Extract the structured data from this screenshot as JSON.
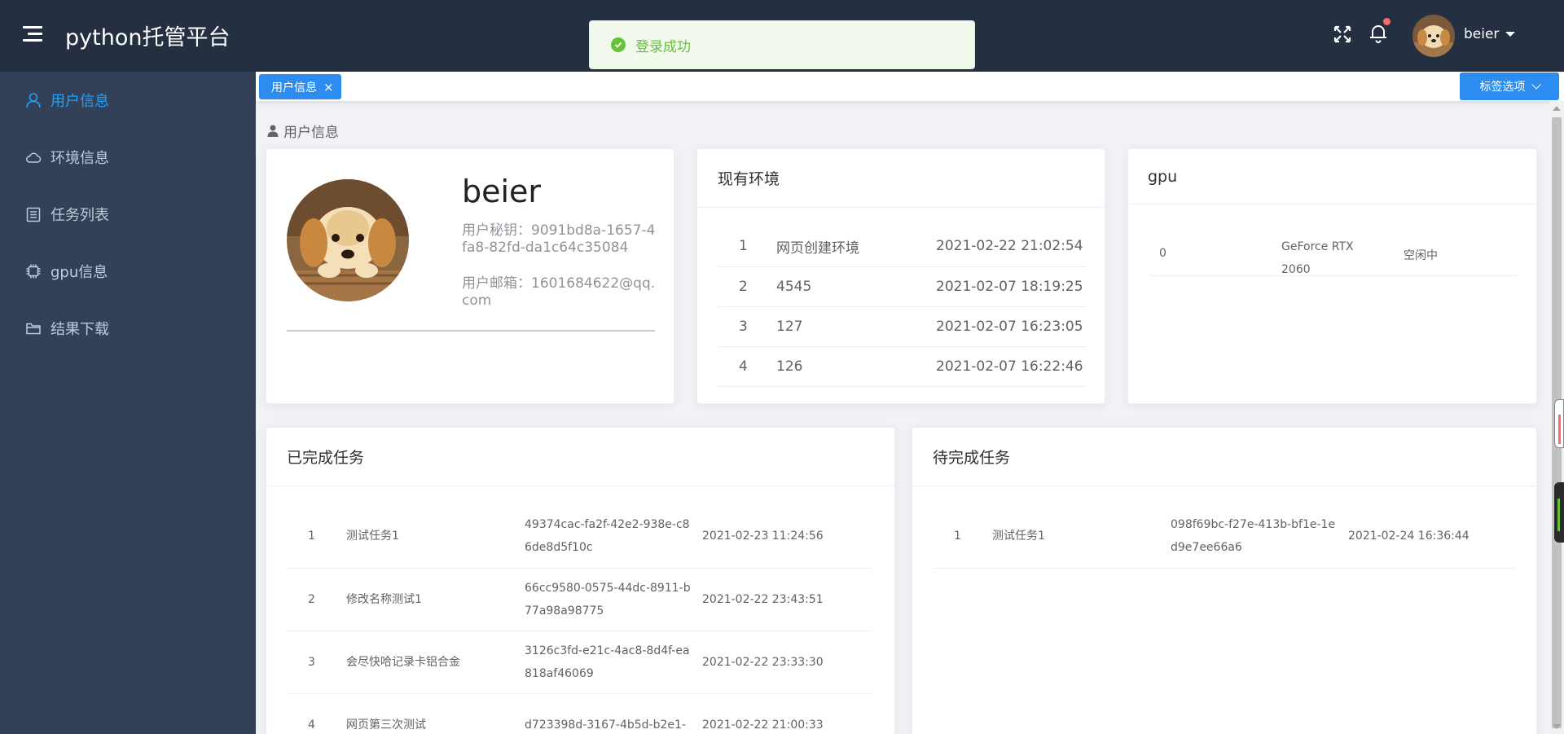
{
  "header": {
    "brand": "python托管平台",
    "username": "beier"
  },
  "toast": {
    "message": "登录成功",
    "color": "#67c23a"
  },
  "sidebar": {
    "items": [
      {
        "label": "用户信息",
        "icon": "user-icon",
        "active": true
      },
      {
        "label": "环境信息",
        "icon": "cloud-icon",
        "active": false
      },
      {
        "label": "任务列表",
        "icon": "list-icon",
        "active": false
      },
      {
        "label": "gpu信息",
        "icon": "chip-icon",
        "active": false
      },
      {
        "label": "结果下载",
        "icon": "folder-icon",
        "active": false
      }
    ]
  },
  "tags": {
    "active_tag": "用户信息",
    "options_label": "标签选项"
  },
  "breadcrumb": {
    "label": "用户信息"
  },
  "user_card": {
    "name": "beier",
    "secret": "用户秘钥：9091bd8a-1657-4fa8-82fd-da1c64c35084",
    "email": "用户邮箱：1601684622@qq.com"
  },
  "env_card": {
    "title": "现有环境",
    "rows": [
      {
        "index": "1",
        "name": "网页创建环境",
        "time": "2021-02-22 21:02:54"
      },
      {
        "index": "2",
        "name": "4545",
        "time": "2021-02-07 18:19:25"
      },
      {
        "index": "3",
        "name": "127",
        "time": "2021-02-07 16:23:05"
      },
      {
        "index": "4",
        "name": "126",
        "time": "2021-02-07 16:22:46"
      }
    ]
  },
  "gpu_card": {
    "title": "gpu",
    "rows": [
      {
        "index": "0",
        "model": "GeForce RTX 2060",
        "status": "空闲中"
      }
    ]
  },
  "done_card": {
    "title": "已完成任务",
    "rows": [
      {
        "index": "1",
        "name": "测试任务1",
        "id": "49374cac-fa2f-42e2-938e-c86de8d5f10c",
        "time": "2021-02-23 11:24:56"
      },
      {
        "index": "2",
        "name": "修改名称测试1",
        "id": "66cc9580-0575-44dc-8911-b77a98a98775",
        "time": "2021-02-22 23:43:51"
      },
      {
        "index": "3",
        "name": "会尽快哈记录卡铝合金",
        "id": "3126c3fd-e21c-4ac8-8d4f-ea818af46069",
        "time": "2021-02-22 23:33:30"
      },
      {
        "index": "4",
        "name": "网页第三次测试",
        "id": "d723398d-3167-4b5d-b2e1-",
        "time": "2021-02-22 21:00:33"
      }
    ]
  },
  "todo_card": {
    "title": "待完成任务",
    "rows": [
      {
        "index": "1",
        "name": "测试任务1",
        "id": "098f69bc-f27e-413b-bf1e-1ed9e7ee66a6",
        "time": "2021-02-24 16:36:44"
      }
    ]
  },
  "colors": {
    "header_bg": "#242f42",
    "sidebar_bg": "#324157",
    "accent": "#20a0ff",
    "tag_blue": "#2d8cf0",
    "success": "#67c23a"
  }
}
